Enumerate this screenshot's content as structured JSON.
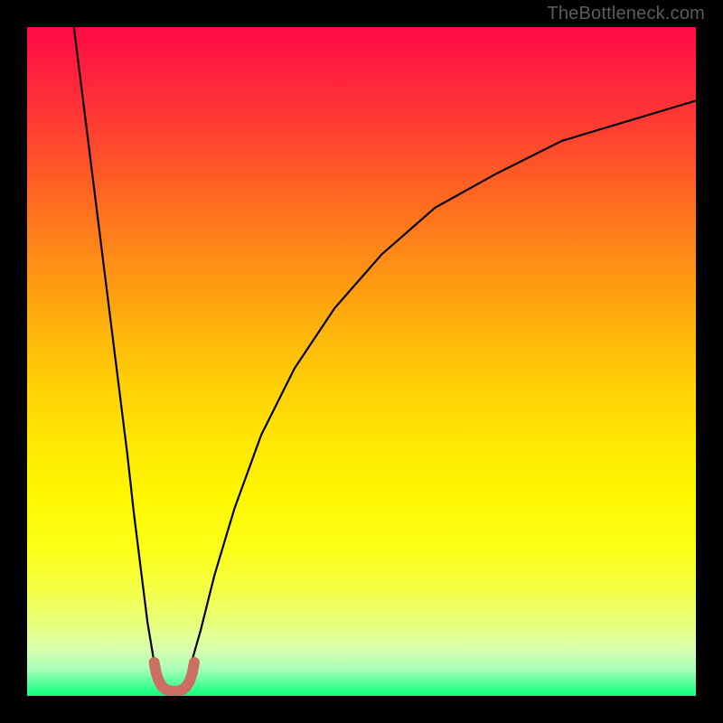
{
  "watermark": {
    "text": "TheBottleneck.com"
  },
  "gradient": {
    "stops": [
      {
        "pos": 0.0,
        "color": "#ff0a46"
      },
      {
        "pos": 0.06,
        "color": "#ff1e3f"
      },
      {
        "pos": 0.14,
        "color": "#ff3a33"
      },
      {
        "pos": 0.22,
        "color": "#ff5a26"
      },
      {
        "pos": 0.3,
        "color": "#ff7a1c"
      },
      {
        "pos": 0.38,
        "color": "#ff9913"
      },
      {
        "pos": 0.46,
        "color": "#ffb60b"
      },
      {
        "pos": 0.54,
        "color": "#ffd106"
      },
      {
        "pos": 0.62,
        "color": "#ffe704"
      },
      {
        "pos": 0.7,
        "color": "#fff700"
      },
      {
        "pos": 0.78,
        "color": "#fcff18"
      },
      {
        "pos": 0.84,
        "color": "#f4ff45"
      },
      {
        "pos": 0.89,
        "color": "#e9ff7a"
      },
      {
        "pos": 0.93,
        "color": "#d8ffaf"
      },
      {
        "pos": 0.96,
        "color": "#a9ffb8"
      },
      {
        "pos": 0.98,
        "color": "#58ff9a"
      },
      {
        "pos": 1.0,
        "color": "#0cff7d"
      }
    ]
  },
  "chart_data": {
    "type": "line",
    "title": "",
    "xlabel": "",
    "ylabel": "",
    "xlim": [
      0,
      100
    ],
    "ylim": [
      0,
      100
    ],
    "series": [
      {
        "name": "left-branch",
        "color": "#000000",
        "x": [
          7,
          8,
          9,
          10,
          11,
          12,
          13,
          14,
          15,
          16,
          17,
          18,
          19,
          20
        ],
        "y": [
          100,
          92,
          84,
          76,
          68,
          60,
          52,
          44,
          36,
          27,
          19,
          11,
          5,
          3
        ]
      },
      {
        "name": "right-branch",
        "color": "#000000",
        "x": [
          24,
          26,
          28,
          31,
          35,
          40,
          46,
          53,
          61,
          70,
          80,
          90,
          100
        ],
        "y": [
          3,
          10,
          18,
          28,
          39,
          49,
          58,
          66,
          73,
          78,
          83,
          86,
          89
        ]
      },
      {
        "name": "bottom-u",
        "color": "#cc6f62",
        "x": [
          19.0,
          19.3,
          19.7,
          20.2,
          20.8,
          21.6,
          22.4,
          23.2,
          23.8,
          24.3,
          24.7,
          25.0
        ],
        "y": [
          5.0,
          3.4,
          2.2,
          1.4,
          0.9,
          0.7,
          0.7,
          0.9,
          1.4,
          2.2,
          3.4,
          5.0
        ]
      }
    ]
  }
}
